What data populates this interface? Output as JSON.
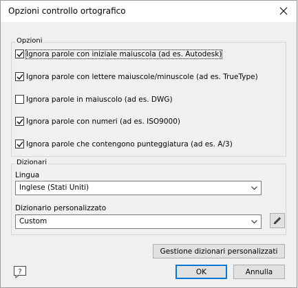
{
  "window": {
    "title": "Opzioni controllo ortografico"
  },
  "options": {
    "group_label": "Opzioni",
    "checkboxes": [
      {
        "label": "Ignora parole con iniziale maiuscola (ad es. Autodesk)",
        "checked": true
      },
      {
        "label": "Ignora parole con lettere maiuscole/minuscole (ad es. TrueType)",
        "checked": true
      },
      {
        "label": "Ignora parole in maiuscolo (ad es. DWG)",
        "checked": false
      },
      {
        "label": "Ignora parole con numeri (ad es. ISO9000)",
        "checked": true
      },
      {
        "label": "Ignora parole che contengono punteggiatura (ad es. A/3)",
        "checked": true
      }
    ]
  },
  "dictionaries": {
    "group_label": "Dizionari",
    "language_label": "Lingua",
    "language_value": "Inglese (Stati Uniti)",
    "custom_label": "Dizionario personalizzato",
    "custom_value": "Custom"
  },
  "buttons": {
    "manage": "Gestione dizionari personalizzati",
    "ok": "OK",
    "cancel": "Annulla",
    "help": "?"
  },
  "icons": {
    "close": "close-icon",
    "edit": "pencil-icon",
    "help": "help-icon",
    "dropdown": "chevron-down-icon"
  }
}
